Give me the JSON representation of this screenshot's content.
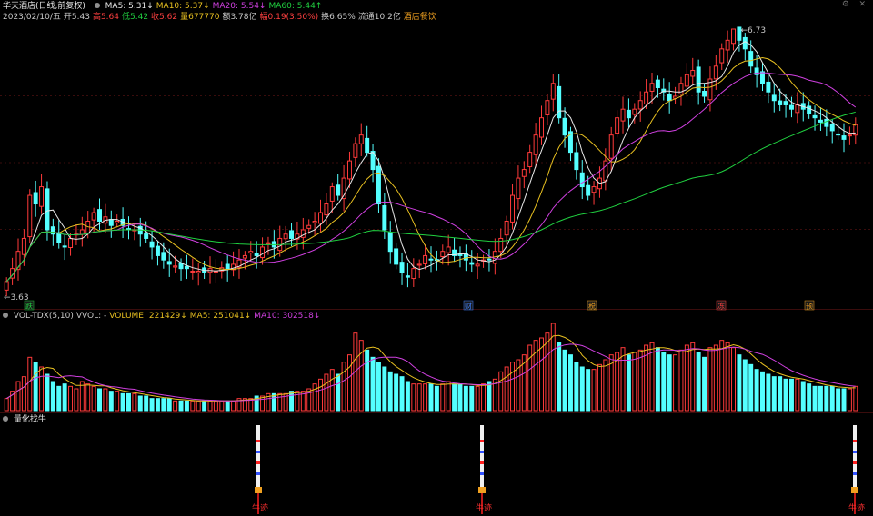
{
  "header": {
    "title": "华天酒店(日线,前复权)",
    "ma_labels": [
      {
        "text": "MA5: 5.31↓",
        "color": "#e8e8e8"
      },
      {
        "text": "MA10: 5.37↓",
        "color": "#e8c020"
      },
      {
        "text": "MA20: 5.54↓",
        "color": "#d040e0"
      },
      {
        "text": "MA60: 5.44↑",
        "color": "#20d040"
      }
    ],
    "info": [
      {
        "text": "2023/02/10/五",
        "color": "#c8c8c8"
      },
      {
        "text": "开5.43",
        "color": "#c8c8c8"
      },
      {
        "text": "高5.64",
        "color": "#ff4040"
      },
      {
        "text": "低5.42",
        "color": "#20d040"
      },
      {
        "text": "收5.62",
        "color": "#ff4040"
      },
      {
        "text": "量677770",
        "color": "#e8c020"
      },
      {
        "text": "额3.78亿",
        "color": "#c8c8c8"
      },
      {
        "text": "幅0.19(3.50%)",
        "color": "#ff4040"
      },
      {
        "text": "换6.65%",
        "color": "#c8c8c8"
      },
      {
        "text": "流通10.2亿",
        "color": "#c8c8c8"
      },
      {
        "text": "酒店餐饮",
        "color": "#f0a020"
      }
    ]
  },
  "vol_header": {
    "items": [
      {
        "text": "VOL-TDX(5,10)",
        "color": "#c8c8c8"
      },
      {
        "text": "VVOL: -",
        "color": "#c8c8c8"
      },
      {
        "text": "VOLUME: 221429↓",
        "color": "#e8c020"
      },
      {
        "text": "MA5: 251041↓",
        "color": "#e8c020"
      },
      {
        "text": "MA10: 302518↓",
        "color": "#d040e0"
      }
    ]
  },
  "signal_header": {
    "title": "量化找牛"
  },
  "annotations": {
    "high": "6.73",
    "low": "3.63"
  },
  "event_markers": [
    {
      "label": "跌",
      "color": "#20d040"
    },
    {
      "label": "财",
      "color": "#4080ff"
    },
    {
      "label": "税",
      "color": "#f0a020"
    },
    {
      "label": "冻",
      "color": "#ff4040"
    },
    {
      "label": "预",
      "color": "#f0a020"
    }
  ],
  "signal_labels": [
    "牛迹",
    "牛迹",
    "牛迹"
  ],
  "colors": {
    "up": "#ff3a3a",
    "down": "#54ffff",
    "ma5": "#e8e8e8",
    "ma10": "#e8c020",
    "ma20": "#d040e0",
    "ma60": "#20d040",
    "grid": "#3a0c0c"
  },
  "chart_data": {
    "type": "candlestick",
    "title": "华天酒店(日线,前复权)",
    "price_range": [
      3.63,
      6.73
    ],
    "last_candle": {
      "date": "2023/02/10",
      "open": 5.43,
      "high": 5.64,
      "low": 5.42,
      "close": 5.62,
      "volume": 677770
    },
    "close_series": [
      3.8,
      3.95,
      4.15,
      4.3,
      4.8,
      4.7,
      4.9,
      4.4,
      4.35,
      4.25,
      4.2,
      4.3,
      4.35,
      4.4,
      4.5,
      4.6,
      4.5,
      4.55,
      4.45,
      4.5,
      4.45,
      4.4,
      4.4,
      4.35,
      4.3,
      4.2,
      4.1,
      4.05,
      4.0,
      3.98,
      3.95,
      3.95,
      3.92,
      3.92,
      3.9,
      3.95,
      3.92,
      3.96,
      3.95,
      4.0,
      4.05,
      4.1,
      4.15,
      4.1,
      4.2,
      4.25,
      4.2,
      4.3,
      4.35,
      4.3,
      4.35,
      4.4,
      4.45,
      4.5,
      4.6,
      4.7,
      4.9,
      4.8,
      5.0,
      5.2,
      5.4,
      5.5,
      5.3,
      5.1,
      4.7,
      4.4,
      4.15,
      4.0,
      3.9,
      3.85,
      3.95,
      4.0,
      4.1,
      4.05,
      4.05,
      4.15,
      4.2,
      4.1,
      4.1,
      4.05,
      4.0,
      4.0,
      4.05,
      4.05,
      4.15,
      4.3,
      4.5,
      4.8,
      5.0,
      5.1,
      5.3,
      5.5,
      5.7,
      5.9,
      6.1,
      5.7,
      5.5,
      5.3,
      5.1,
      4.9,
      4.8,
      4.9,
      5.0,
      5.2,
      5.5,
      5.7,
      5.8,
      5.7,
      5.8,
      5.9,
      6.0,
      6.1,
      6.05,
      6.0,
      5.9,
      5.95,
      6.1,
      6.2,
      6.25,
      6.0,
      5.95,
      6.15,
      6.3,
      6.5,
      6.6,
      6.73,
      6.6,
      6.5,
      6.3,
      6.2,
      6.1,
      6.0,
      5.9,
      5.85,
      5.85,
      5.8,
      5.85,
      5.8,
      5.75,
      5.7,
      5.65,
      5.6,
      5.55,
      5.5,
      5.45,
      5.5,
      5.62
    ],
    "volume_series": [
      50,
      80,
      120,
      140,
      220,
      200,
      180,
      150,
      120,
      100,
      110,
      100,
      90,
      120,
      110,
      100,
      90,
      90,
      80,
      80,
      70,
      70,
      70,
      60,
      60,
      50,
      50,
      50,
      50,
      40,
      40,
      40,
      40,
      40,
      40,
      40,
      40,
      40,
      40,
      40,
      50,
      50,
      50,
      60,
      60,
      70,
      70,
      70,
      70,
      80,
      80,
      80,
      90,
      110,
      130,
      150,
      170,
      150,
      200,
      230,
      320,
      290,
      250,
      220,
      200,
      180,
      160,
      150,
      140,
      120,
      110,
      110,
      110,
      110,
      100,
      110,
      120,
      110,
      110,
      100,
      100,
      100,
      110,
      120,
      130,
      160,
      180,
      200,
      210,
      230,
      270,
      290,
      300,
      320,
      360,
      280,
      250,
      230,
      200,
      180,
      170,
      170,
      190,
      210,
      230,
      240,
      260,
      230,
      240,
      250,
      270,
      280,
      260,
      240,
      230,
      230,
      250,
      270,
      280,
      240,
      220,
      260,
      270,
      290,
      280,
      260,
      230,
      210,
      190,
      170,
      160,
      150,
      140,
      140,
      130,
      130,
      130,
      120,
      110,
      100,
      100,
      100,
      100,
      90,
      90,
      90,
      100
    ]
  }
}
